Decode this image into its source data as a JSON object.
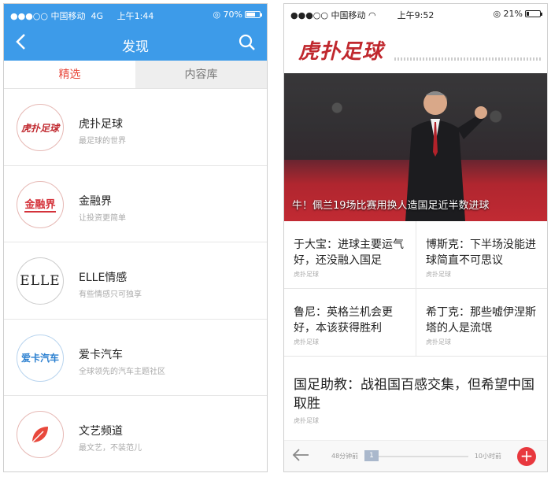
{
  "left_screen": {
    "status_bar": {
      "carrier": "●●●○○ 中国移动",
      "network": "4G",
      "time": "上午1:44",
      "battery": "70%",
      "battery_level": 0.7
    },
    "nav": {
      "title": "发现",
      "back_icon": "chevron-left-icon",
      "search_icon": "search-icon"
    },
    "tabs": [
      {
        "label": "精选",
        "active": true
      },
      {
        "label": "内容库",
        "active": false
      }
    ],
    "items": [
      {
        "name": "虎扑足球",
        "desc": "最足球的世界",
        "logo": "虎扑足球",
        "logo_color": "#c0282e"
      },
      {
        "name": "金融界",
        "desc": "让投资更简单",
        "logo": "金融界",
        "logo_color": "#d4323a"
      },
      {
        "name": "ELLE情感",
        "desc": "有些情感只可独享",
        "logo": "ELLE",
        "logo_color": "#222222"
      },
      {
        "name": "爱卡汽车",
        "desc": "全球领先的汽车主题社区",
        "logo": "爱卡汽车",
        "logo_color": "#2a7fd0"
      },
      {
        "name": "文艺频道",
        "desc": "最文艺，不装范儿",
        "logo": "leaf-icon",
        "logo_color": "#e8483c"
      }
    ],
    "accent_color": "#3d9be9"
  },
  "right_screen": {
    "status_bar": {
      "carrier": "●●●○○ 中国移动",
      "time": "上午9:52",
      "battery": "21%",
      "battery_level": 0.21
    },
    "brand": "虎扑足球",
    "hero_caption": "牛！佩兰19场比赛用换人造国足近半数进球",
    "news": [
      {
        "headline": "于大宝：进球主要运气好，还没融入国足",
        "source": "虎扑足球"
      },
      {
        "headline": "博斯克：下半场没能进球简直不可思议",
        "source": "虎扑足球"
      },
      {
        "headline": "鲁尼：英格兰机会更好，本该获得胜利",
        "source": "虎扑足球"
      },
      {
        "headline": "希丁克：那些嘘伊涅斯塔的人是流氓",
        "source": "虎扑足球"
      }
    ],
    "featured": {
      "headline": "国足助教：战祖国百感交集，但希望中国取胜",
      "source": "虎扑足球"
    },
    "footer": {
      "time_start": "48分钟前",
      "page": "1",
      "time_end": "10小时前",
      "back_icon": "arrow-left-icon",
      "add_icon": "plus-icon"
    }
  }
}
